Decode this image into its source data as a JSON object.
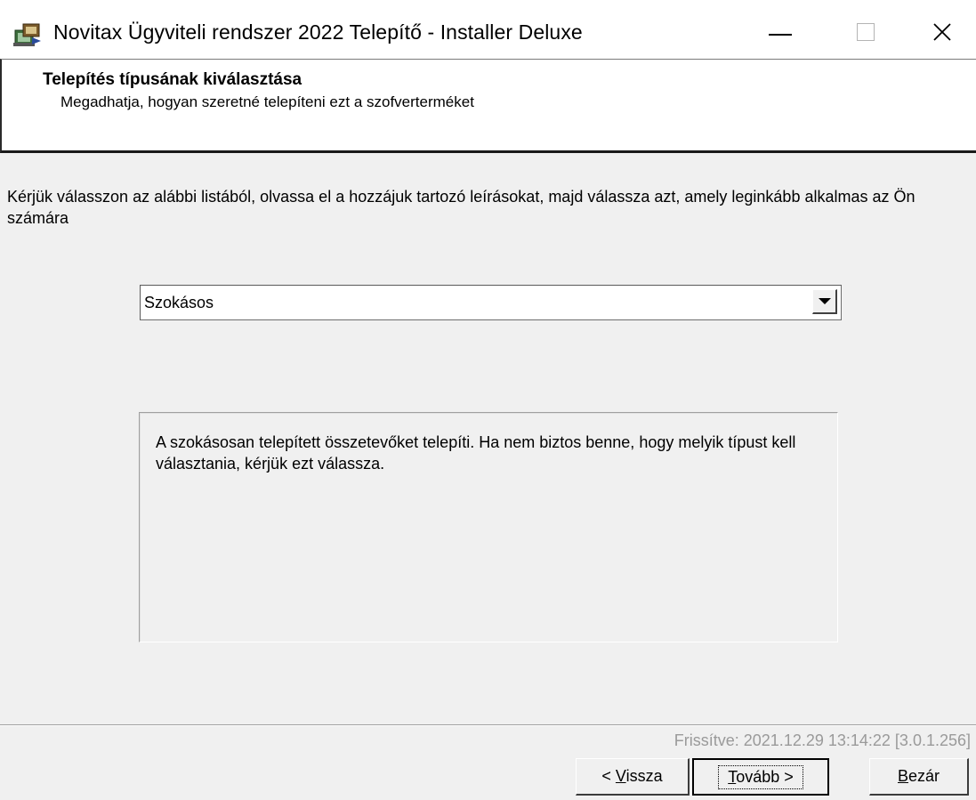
{
  "window": {
    "title": "Novitax Ügyviteli rendszer 2022 Telepítő - Installer Deluxe",
    "icon": "installer-icon",
    "controls": {
      "minimize": "minimize-icon",
      "maximize": "maximize-icon",
      "close": "close-icon"
    }
  },
  "header": {
    "title": "Telepítés típusának kiválasztása",
    "subtitle": "Megadhatja, hogyan szeretné telepíteni ezt a szofverterméket"
  },
  "body": {
    "instructions": "Kérjük válasszon az alábbi listából, olvassa el a hozzájuk tartozó leírásokat, majd válassza azt, amely leginkább alkalmas az Ön számára",
    "install_type": {
      "selected": "Szokásos"
    },
    "description": "A szokásosan telepített összetevőket telepíti. Ha nem biztos benne, hogy melyik típust kell választania, kérjük ezt válassza."
  },
  "footer": {
    "updated": "Frissítve: 2021.12.29  13:14:22  [3.0.1.256]",
    "back": {
      "prefix": "< ",
      "accel": "V",
      "rest": "issza"
    },
    "next": {
      "accel": "T",
      "rest": "ovább >"
    },
    "close": {
      "accel": "B",
      "rest": "ezár"
    }
  }
}
